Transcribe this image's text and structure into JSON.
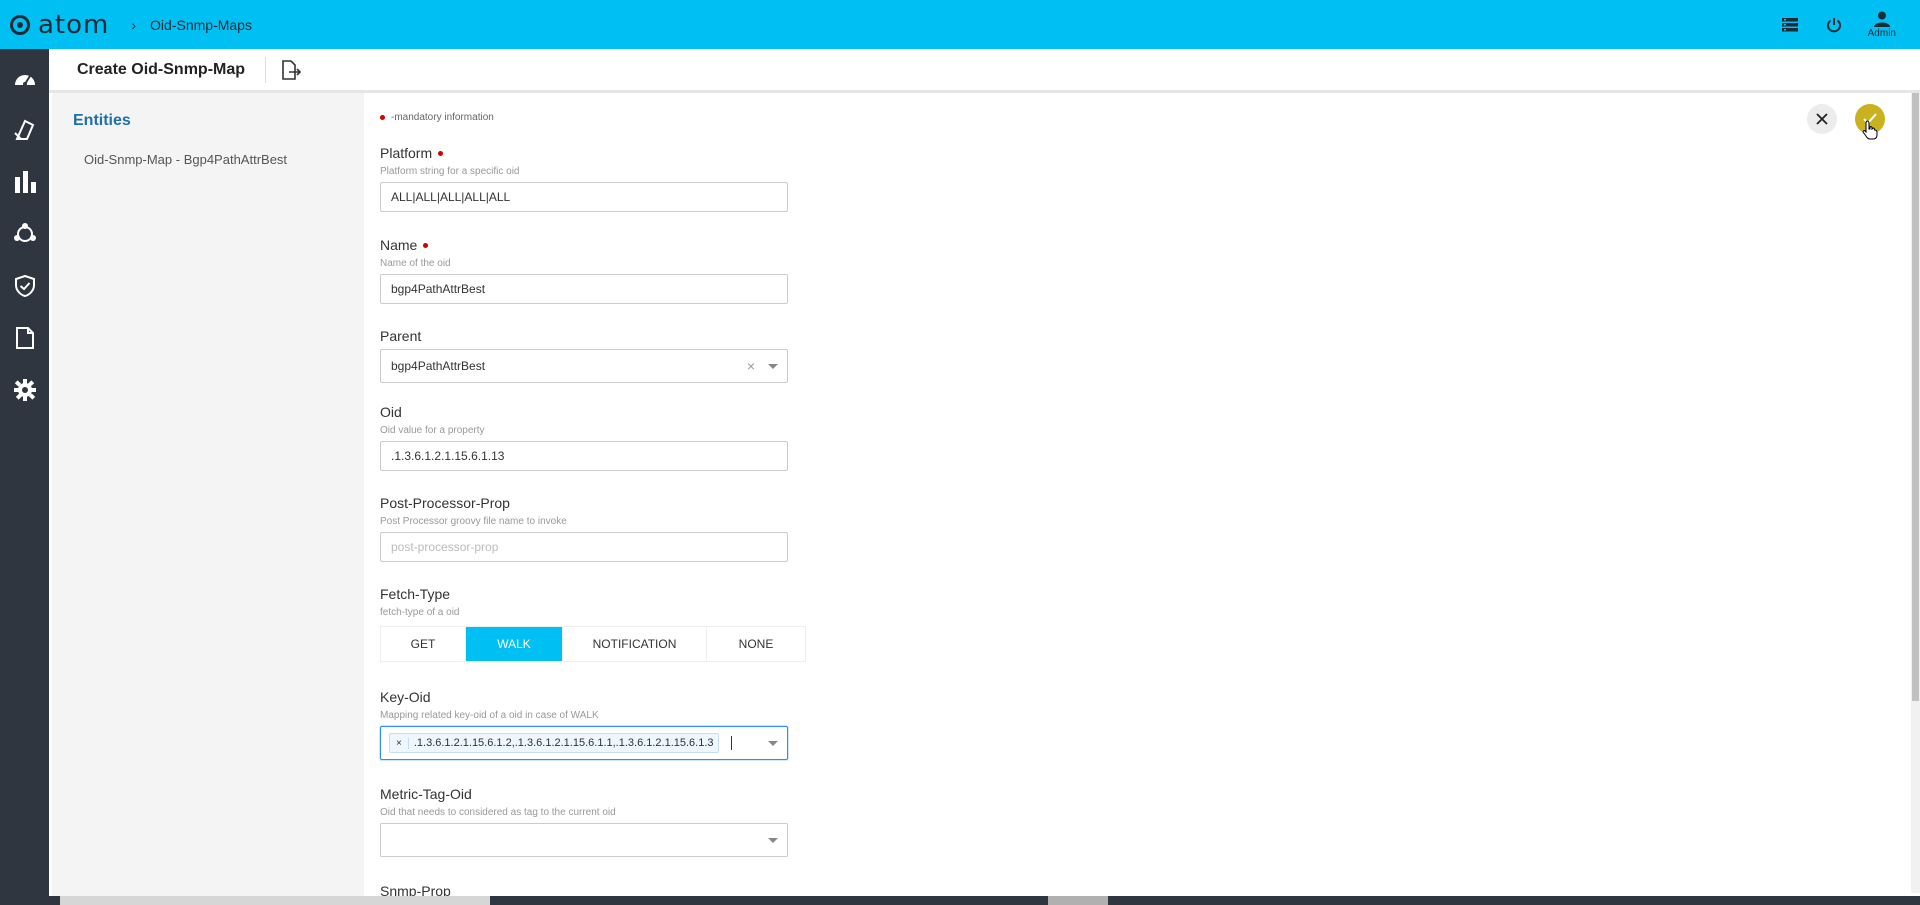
{
  "app": {
    "logo_text": "atom",
    "breadcrumb": "Oid-Snmp-Maps",
    "user_label": "Admin"
  },
  "colors": {
    "topbar": "#00c0f3",
    "sidebar": "#2f3640",
    "accent": "#00c0f3",
    "save": "#c9b21e",
    "link": "#1f6fa8",
    "required": "#d40000"
  },
  "left_nav": {
    "items": [
      {
        "icon": "dashboard-icon"
      },
      {
        "icon": "devices-icon"
      },
      {
        "icon": "bar-chart-icon"
      },
      {
        "icon": "topology-icon"
      },
      {
        "icon": "shield-check-icon"
      },
      {
        "icon": "document-icon"
      },
      {
        "icon": "settings-icon"
      }
    ]
  },
  "subheader": {
    "title": "Create Oid-Snmp-Map"
  },
  "entities": {
    "title": "Entities",
    "item": "Oid-Snmp-Map - Bgp4PathAttrBest"
  },
  "form": {
    "mandatory_text": "-mandatory information",
    "platform": {
      "label": "Platform",
      "hint": "Platform string for a specific oid",
      "value": "ALL|ALL|ALL|ALL|ALL"
    },
    "name": {
      "label": "Name",
      "hint": "Name of the oid",
      "value": "bgp4PathAttrBest"
    },
    "parent": {
      "label": "Parent",
      "value": "bgp4PathAttrBest",
      "clear": "×"
    },
    "oid": {
      "label": "Oid",
      "hint": "Oid value for a property",
      "value": ".1.3.6.1.2.1.15.6.1.13"
    },
    "post_processor": {
      "label": "Post-Processor-Prop",
      "hint": "Post Processor groovy file name to invoke",
      "placeholder": "post-processor-prop"
    },
    "fetch_type": {
      "label": "Fetch-Type",
      "hint": "fetch-type of a oid",
      "options": [
        "GET",
        "WALK",
        "NOTIFICATION",
        "NONE"
      ],
      "selected": "WALK"
    },
    "key_oid": {
      "label": "Key-Oid",
      "hint": "Mapping related key-oid of a oid in case of WALK",
      "chip_remove": "×",
      "chip_value": ".1.3.6.1.2.1.15.6.1.2,.1.3.6.1.2.1.15.6.1.1,.1.3.6.1.2.1.15.6.1.3"
    },
    "metric_tag_oid": {
      "label": "Metric-Tag-Oid",
      "hint": "Oid that needs to considered as tag to the current oid",
      "value": ""
    },
    "snmp_prop": {
      "label": "Snmp-Prop"
    }
  }
}
